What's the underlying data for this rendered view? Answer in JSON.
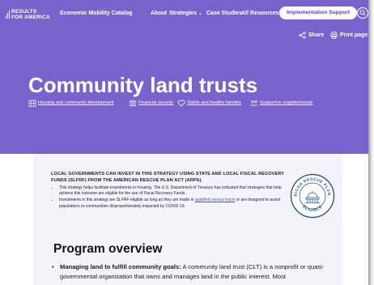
{
  "nav": {
    "logo_line1": "RESULTS",
    "logo_line2": "FOR AMERICA",
    "brand": "Economic Mobility Catalog",
    "about": "About",
    "strategies": "Strategies",
    "case_studies": "Case Studies",
    "all_resources": "All Resources",
    "implementation_support": "Implementation Support"
  },
  "actions": {
    "share": "Share",
    "print": "Print page"
  },
  "page_title": "Community land trusts",
  "tags": [
    {
      "label": "Housing and community development",
      "icon": "building-icon"
    },
    {
      "label": "Financial security",
      "icon": "bank-icon"
    },
    {
      "label": "Stable and healthy families",
      "icon": "heart-icon"
    },
    {
      "label": "Supportive neighborhoods",
      "icon": "people-icon"
    }
  ],
  "notice": {
    "heading": "LOCAL GOVERNMENTS CAN INVEST IN THIS STRATEGY USING STATE AND LOCAL FISCAL RECOVERY FUNDS (SLFRF) FROM THE AMERICAN RESCUE PLAN ACT (ARPA).",
    "bullet1": "This strategy helps facilitate investments in housing. The U.S. Department of Treasury has indicated that strategies that help achieve this outcome are eligible for the use of Fiscal Recovery Funds.",
    "bullet2_before": "Investments in this strategy are SLFRF-eligible as long as they are made in ",
    "bullet2_link": "qualified census tracts",
    "bullet2_after": " or are designed to assist populations or communities disproportionately impacted by COVID-19.",
    "seal_top": "AMERICAN RESCUE PLAN ACT",
    "seal_bottom": "ELIGIBLE"
  },
  "overview": {
    "heading": "Program overview",
    "bullet_bold": "Managing land to fulfill community goals:",
    "bullet_text": " A community land trust (CLT) is a nonprofit or quasi-governmental organization that owns and manages land in the public interest. Most"
  },
  "colors": {
    "hero_purple": "#7a62cc",
    "card_background": "#f4f3fb",
    "link_blue": "#3b55c9",
    "seal_blue": "#2a5a8c"
  }
}
